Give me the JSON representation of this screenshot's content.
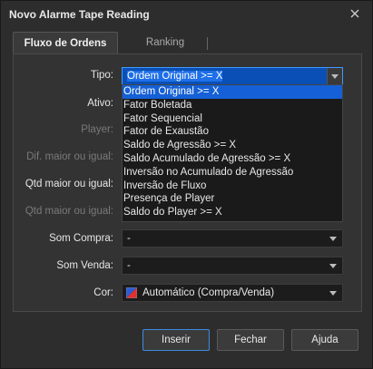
{
  "window": {
    "title": "Novo Alarme Tape Reading"
  },
  "tabs": [
    {
      "label": "Fluxo de Ordens"
    },
    {
      "label": "Ranking"
    }
  ],
  "form": {
    "tipo": {
      "label": "Tipo:",
      "value": "Ordem Original >= X"
    },
    "ativo": {
      "label": "Ativo:"
    },
    "player": {
      "label": "Player:"
    },
    "dif_maior": {
      "label": "Dif. maior ou igual:"
    },
    "qtd_maior": {
      "label": "Qtd maior ou igual:"
    },
    "qtd_maior2": {
      "label": "Qtd maior ou igual:"
    },
    "som_compra": {
      "label": "Som Compra:",
      "value": "-"
    },
    "som_venda": {
      "label": "Som Venda:",
      "value": "-"
    },
    "cor": {
      "label": "Cor:",
      "value": "Automático (Compra/Venda)",
      "swatch_colors": [
        "#2c5cd6",
        "#e03030"
      ]
    }
  },
  "dropdown": {
    "options": [
      "Ordem Original >= X",
      "Fator Boletada",
      "Fator Sequencial",
      "Fator de Exaustão",
      "Saldo de Agressão >= X",
      "Saldo Acumulado de Agressão >= X",
      "Inversão no Acumulado de Agressão",
      "Inversão de Fluxo",
      "Presença de Player",
      "Saldo do Player >= X"
    ],
    "selected_index": 0
  },
  "buttons": {
    "inserir": "Inserir",
    "fechar": "Fechar",
    "ajuda": "Ajuda"
  },
  "colors": {
    "selection": "#1560d6",
    "focus_border": "#3f9bff",
    "primary_border": "#3f8be0"
  }
}
